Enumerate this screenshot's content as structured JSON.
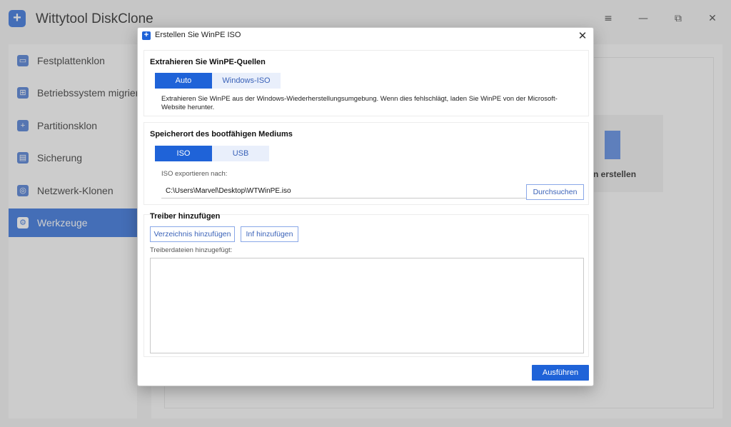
{
  "app": {
    "title": "Wittytool DiskClone",
    "window_controls": {
      "menu": "≡",
      "minimize": "—",
      "restore": "⧉",
      "close": "✕"
    }
  },
  "sidebar": {
    "items": [
      {
        "label": "Festplattenklon",
        "icon": "disk-icon"
      },
      {
        "label": "Betriebssystem migrieren",
        "icon": "os-migrate-icon"
      },
      {
        "label": "Partitionsklon",
        "icon": "partition-icon"
      },
      {
        "label": "Sicherung",
        "icon": "backup-icon"
      },
      {
        "label": "Netzwerk-Klonen",
        "icon": "network-icon"
      },
      {
        "label": "Werkzeuge",
        "icon": "gear-icon",
        "active": true
      }
    ]
  },
  "main": {
    "card_label": "n erstellen"
  },
  "dialog": {
    "title": "Erstellen Sie WinPE ISO",
    "source": {
      "heading": "Extrahieren Sie WinPE-Quellen",
      "options": [
        "Auto",
        "Windows-ISO"
      ],
      "selected": "Auto",
      "description": "Extrahieren Sie WinPE aus der Windows-Wiederherstellungsumgebung. Wenn dies fehlschlägt, laden Sie WinPE von der Microsoft-Website herunter."
    },
    "media": {
      "heading": "Speicherort des bootfähigen Mediums",
      "options": [
        "ISO",
        "USB"
      ],
      "selected": "ISO",
      "export_label": "ISO exportieren nach:",
      "path": "C:\\Users\\Marvel\\Desktop\\WTWinPE.iso",
      "browse_label": "Durchsuchen"
    },
    "drivers": {
      "heading": "Treiber hinzufügen",
      "add_dir_label": "Verzeichnis hinzufügen",
      "add_inf_label": "Inf hinzufügen",
      "added_label": "Treiberdateien hinzugefügt:"
    },
    "run_label": "Ausführen"
  },
  "colors": {
    "accent": "#1f63d8",
    "accent_light": "#e9effb",
    "outline": "#8aa8e8"
  }
}
